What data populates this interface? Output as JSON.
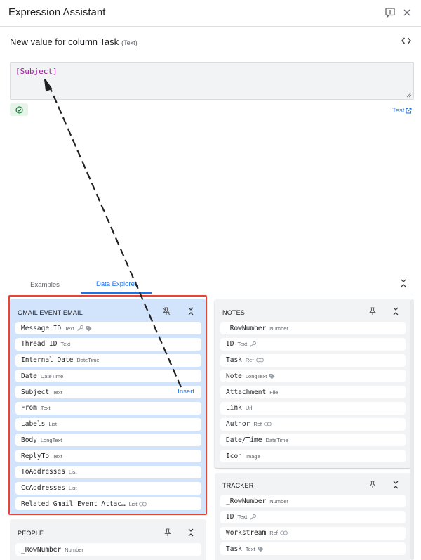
{
  "app": {
    "title": "Expression Assistant"
  },
  "column_prompt": {
    "text": "New value for column Task",
    "type": "(Text)"
  },
  "expression": {
    "value": "[Subject]"
  },
  "test_link": {
    "label": "Test"
  },
  "tabs": [
    {
      "label": "Examples",
      "active": false
    },
    {
      "label": "Data Explorer",
      "active": true
    }
  ],
  "colors": {
    "accent": "#1a73e8",
    "highlight_frame": "#ea4335",
    "expression_text": "#a0199c",
    "selected_card": "#d2e3fc",
    "card": "#f1f3f4"
  },
  "cards": {
    "gmail": {
      "title": "GMAIL EVENT EMAIL",
      "insert_label": "Insert",
      "rows": [
        {
          "name": "Message ID",
          "type": "Text",
          "icons": [
            "key-icon",
            "tag-icon"
          ]
        },
        {
          "name": "Thread ID",
          "type": "Text",
          "icons": []
        },
        {
          "name": "Internal Date",
          "type": "DateTime",
          "icons": []
        },
        {
          "name": "Date",
          "type": "DateTime",
          "icons": []
        },
        {
          "name": "Subject",
          "type": "Text",
          "icons": []
        },
        {
          "name": "From",
          "type": "Text",
          "icons": []
        },
        {
          "name": "Labels",
          "type": "List",
          "icons": []
        },
        {
          "name": "Body",
          "type": "LongText",
          "icons": []
        },
        {
          "name": "ReplyTo",
          "type": "Text",
          "icons": []
        },
        {
          "name": "ToAddresses",
          "type": "List",
          "icons": []
        },
        {
          "name": "CcAddresses",
          "type": "List",
          "icons": []
        },
        {
          "name": "Related Gmail Event Attac…",
          "type": "List",
          "icons": [
            "link-icon"
          ]
        }
      ]
    },
    "people": {
      "title": "PEOPLE",
      "rows": [
        {
          "name": "_RowNumber",
          "type": "Number",
          "icons": []
        }
      ]
    },
    "notes": {
      "title": "NOTES",
      "rows": [
        {
          "name": "_RowNumber",
          "type": "Number",
          "icons": []
        },
        {
          "name": "ID",
          "type": "Text",
          "icons": [
            "key-icon"
          ]
        },
        {
          "name": "Task",
          "type": "Ref",
          "icons": [
            "link-icon"
          ]
        },
        {
          "name": "Note",
          "type": "LongText",
          "icons": [
            "tag-icon"
          ]
        },
        {
          "name": "Attachment",
          "type": "File",
          "icons": []
        },
        {
          "name": "Link",
          "type": "Url",
          "icons": []
        },
        {
          "name": "Author",
          "type": "Ref",
          "icons": [
            "link-icon"
          ]
        },
        {
          "name": "Date/Time",
          "type": "DateTime",
          "icons": []
        },
        {
          "name": "Icon",
          "type": "Image",
          "icons": []
        }
      ]
    },
    "tracker": {
      "title": "TRACKER",
      "rows": [
        {
          "name": "_RowNumber",
          "type": "Number",
          "icons": []
        },
        {
          "name": "ID",
          "type": "Text",
          "icons": [
            "key-icon"
          ]
        },
        {
          "name": "Workstream",
          "type": "Ref",
          "icons": [
            "link-icon"
          ]
        },
        {
          "name": "Task",
          "type": "Text",
          "icons": [
            "tag-icon"
          ]
        }
      ]
    }
  }
}
